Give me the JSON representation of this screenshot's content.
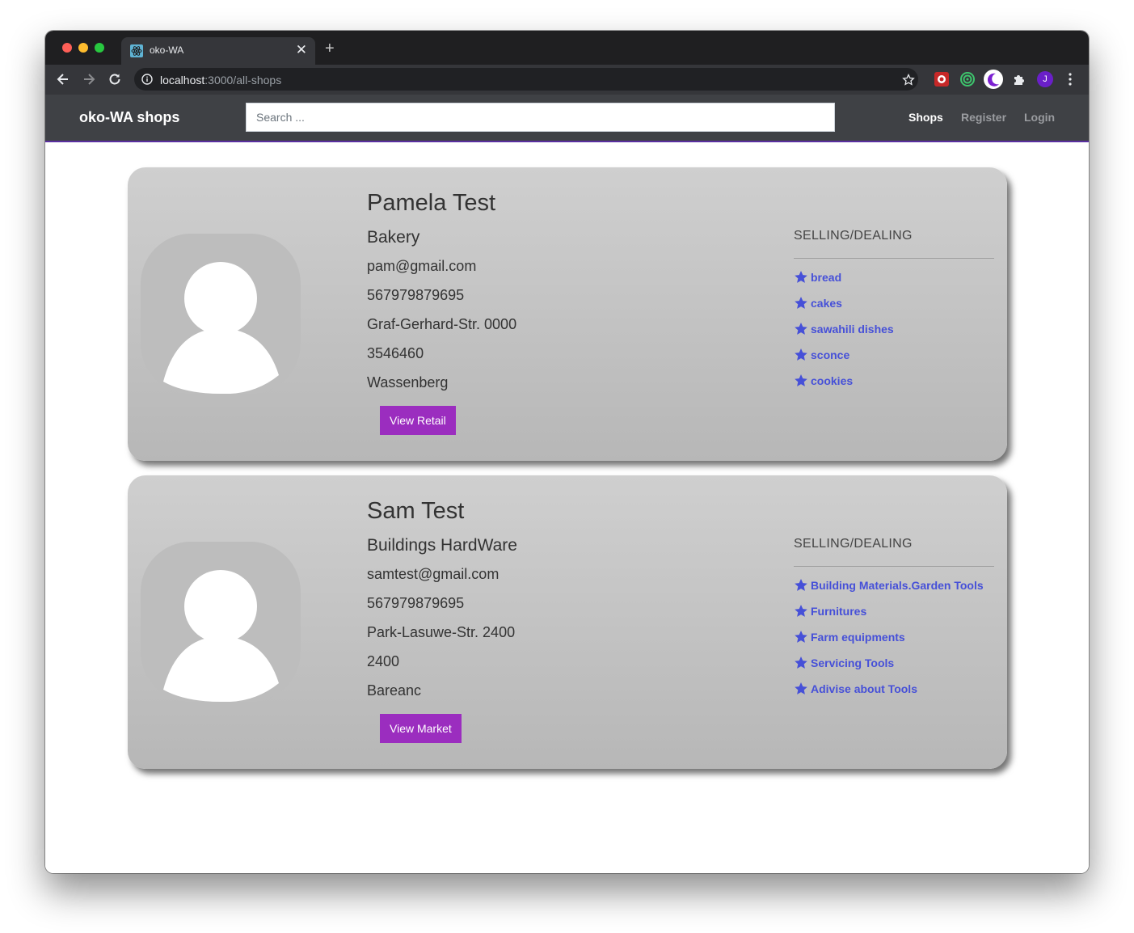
{
  "browser": {
    "tab_title": "oko-WA",
    "url_host": "localhost",
    "url_path": ":3000/all-shops",
    "new_tab_symbol": "+",
    "close_symbol": "✕",
    "profile_initial": "J"
  },
  "navbar": {
    "brand": "oko-WA shops",
    "search_placeholder": "Search ...",
    "links": [
      {
        "label": "Shops",
        "active": true
      },
      {
        "label": "Register",
        "active": false
      },
      {
        "label": "Login",
        "active": false
      }
    ]
  },
  "colors": {
    "button": "#9b2dbf",
    "item_link": "#4650d8",
    "navbar": "#3f4145"
  },
  "shops": [
    {
      "name": "Pamela Test",
      "category": "Bakery",
      "email": "pam@gmail.com",
      "phone": "567979879695",
      "street": "Graf-Gerhard-Str. 0000",
      "postcode": "3546460",
      "city": "Wassenberg",
      "button_label": "View Retail",
      "selling_title": "SELLING/DEALING",
      "items": [
        "bread",
        "cakes",
        "sawahili dishes",
        "sconce",
        "cookies"
      ]
    },
    {
      "name": "Sam Test",
      "category": "Buildings HardWare",
      "email": "samtest@gmail.com",
      "phone": "567979879695",
      "street": "Park-Lasuwe-Str. 2400",
      "postcode": "2400",
      "city": "Bareanc",
      "button_label": "View Market",
      "selling_title": "SELLING/DEALING",
      "items": [
        "Building Materials.Garden Tools",
        "Furnitures",
        "Farm equipments",
        "Servicing Tools",
        "Adivise about Tools"
      ]
    }
  ]
}
